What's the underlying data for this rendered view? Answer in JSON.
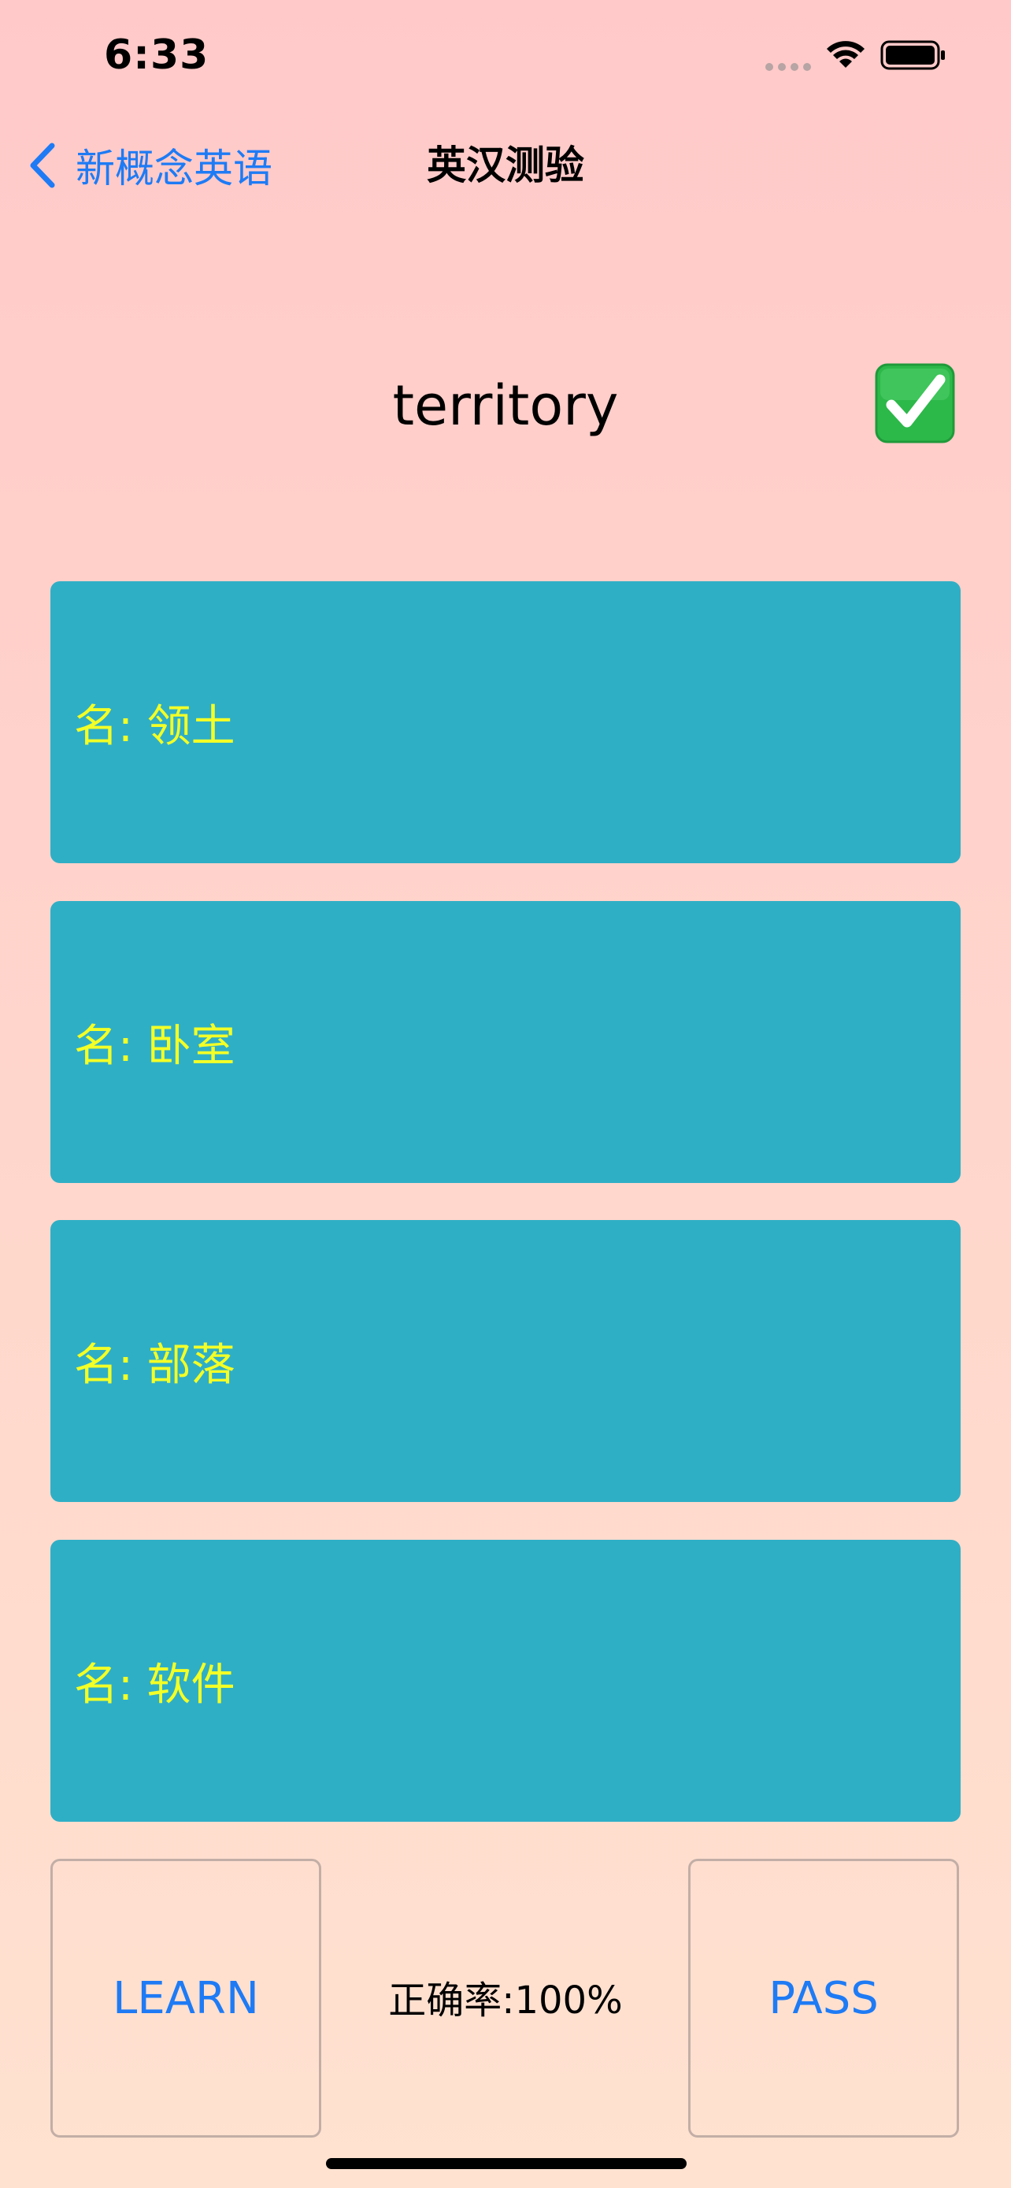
{
  "status_bar": {
    "time": "6:33",
    "wifi_icon": "wifi-icon",
    "battery_icon": "battery-full-icon"
  },
  "nav": {
    "back_label": "新概念英语",
    "title": "英汉测验",
    "accent_color": "#1e7bf5"
  },
  "question": {
    "word": "territory",
    "result_icon": "check-mark-icon",
    "result_color": "#2db84a"
  },
  "options": [
    {
      "label": "名: 领土"
    },
    {
      "label": "名: 卧室"
    },
    {
      "label": "名: 部落"
    },
    {
      "label": "名: 软件"
    }
  ],
  "option_style": {
    "background": "#2fafc6",
    "text_color": "#f3ff26"
  },
  "controls": {
    "learn_label": "LEARN",
    "accuracy_text": "正确率:100%",
    "pass_label": "PASS"
  }
}
